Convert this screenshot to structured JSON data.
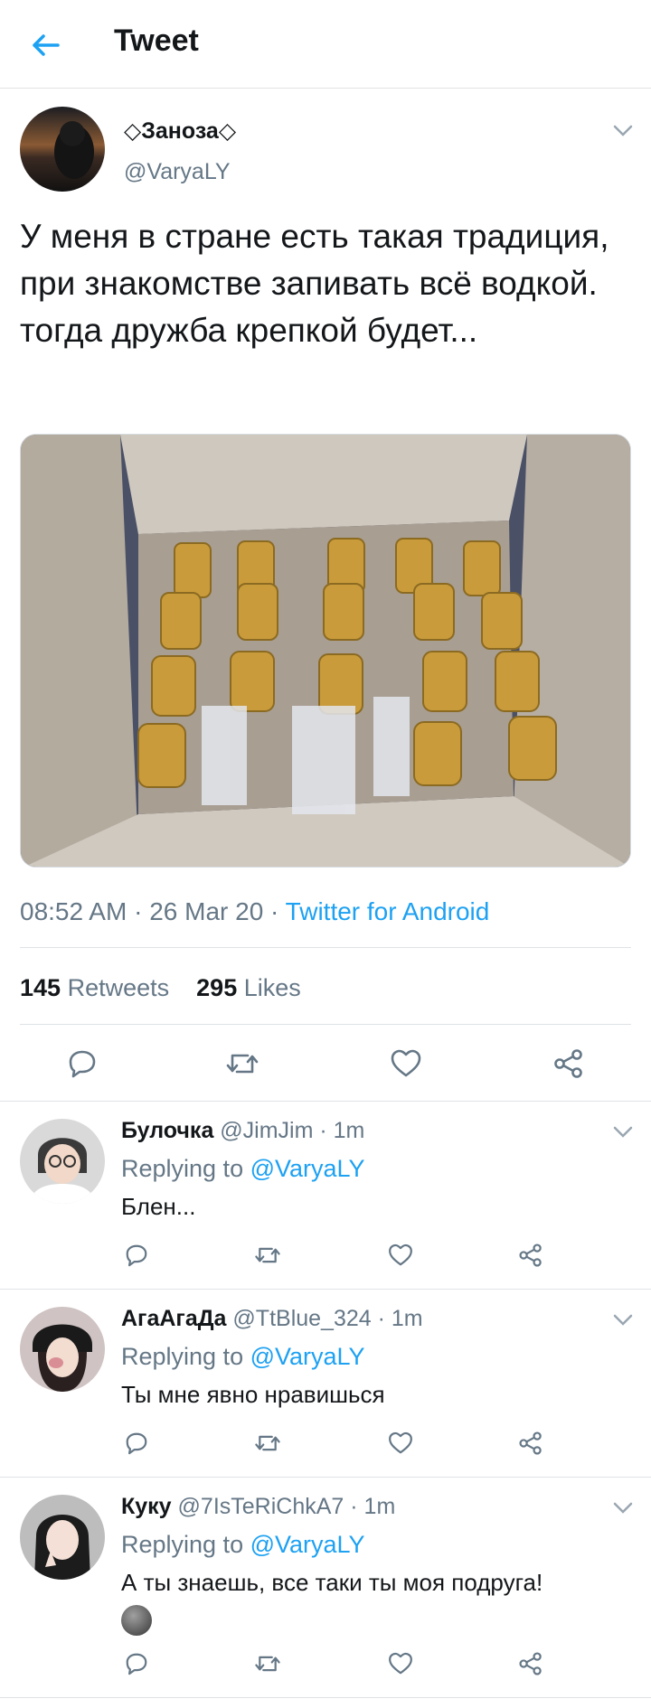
{
  "header": {
    "title": "Tweet"
  },
  "tweet": {
    "author_name": "◇Заноза◇",
    "author_handle": "@VaryaLY",
    "text": "У меня в стране есть такая традиция, при знакомстве запивать всё водкой. тогда дружба крепкой будет...",
    "time": "08:52 AM",
    "date": "26 Mar 20",
    "source": "Twitter for Android",
    "retweets_count": "145",
    "retweets_label": "Retweets",
    "likes_count": "295",
    "likes_label": "Likes"
  },
  "replies": [
    {
      "name": "Булочка",
      "meta": "@JimJim · 1m",
      "replying_label": "Replying to",
      "replying_handle": "@VaryaLY",
      "text": "Блен..."
    },
    {
      "name": "АгаАгаДа",
      "meta": "@TtBlue_324 · 1m",
      "replying_label": "Replying to",
      "replying_handle": "@VaryaLY",
      "text": "Ты мне явно нравишься"
    },
    {
      "name": "Куку",
      "meta": "@7IsTeRiChkA7 · 1m",
      "replying_label": "Replying to",
      "replying_handle": "@VaryaLY",
      "text": "А ты знаешь, все таки ты моя подруга!"
    }
  ],
  "colors": {
    "accent": "#1da1f2",
    "secondary_text": "#657786",
    "divider": "#dfe3e6"
  },
  "icons": [
    "back-arrow-icon",
    "chevron-down-icon",
    "reply-icon",
    "retweet-icon",
    "like-icon",
    "share-icon",
    "moon-emoji-icon"
  ]
}
